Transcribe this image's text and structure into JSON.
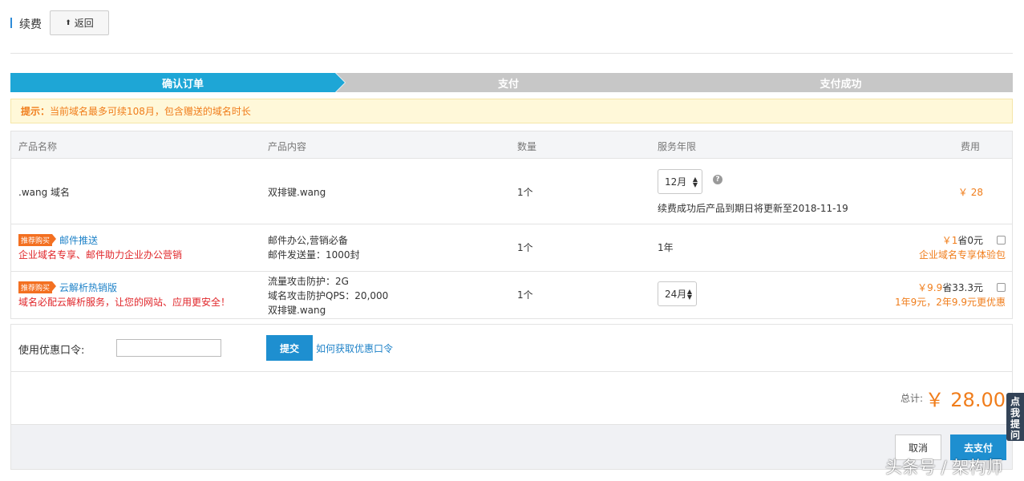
{
  "header": {
    "title": "续费",
    "back_icon": "⬆",
    "back_label": "返回"
  },
  "steps": [
    "确认订单",
    "支付",
    "支付成功"
  ],
  "tip": {
    "label": "提示：",
    "text": "当前域名最多可续108月，包含赠送的域名时长"
  },
  "table": {
    "columns": [
      "产品名称",
      "产品内容",
      "数量",
      "服务年限",
      "费用"
    ],
    "row1": {
      "name": ".wang 域名",
      "content": "双排键.wang",
      "qty": "1个",
      "term_select": "12月",
      "term_note": "续费成功后产品到期日将更新至2018-11-19",
      "fee": "￥ 28"
    },
    "row2": {
      "badge": "推荐购买",
      "name": "邮件推送",
      "desc": "企业域名专享、邮件助力企业办公营销",
      "content_1": "邮件办公,营销必备",
      "content_2": "邮件发送量：1000封",
      "qty": "1个",
      "term": "1年",
      "price": "￥1",
      "save": "省0元",
      "promo": "企业域名专享体验包"
    },
    "row3": {
      "badge": "推荐购买",
      "name": "云解析热销版",
      "desc": "域名必配云解析服务，让您的网站、应用更安全！",
      "content_1": "流量攻击防护：2G",
      "content_2": "域名攻击防护QPS：20,000",
      "content_3": "双排键.wang",
      "qty": "1个",
      "term_select": "24月",
      "price": "￥9.9",
      "save": "省33.3元",
      "promo": "1年9元，2年9.9元更优惠"
    }
  },
  "coupon": {
    "label": "使用优惠口令:",
    "placeholder": "",
    "submit": "提交",
    "help_link": "如何获取优惠口令"
  },
  "total": {
    "label": "总计:",
    "value": "￥ 28.00"
  },
  "actions": {
    "cancel": "取消",
    "pay": "去支付"
  },
  "side_help": "点我提问",
  "watermark": "头条号 / 架构师",
  "colors": {
    "accent": "#1ea6d6",
    "button": "#1e8fd0",
    "price": "#f07d1b",
    "promo_red": "#e0262a"
  }
}
